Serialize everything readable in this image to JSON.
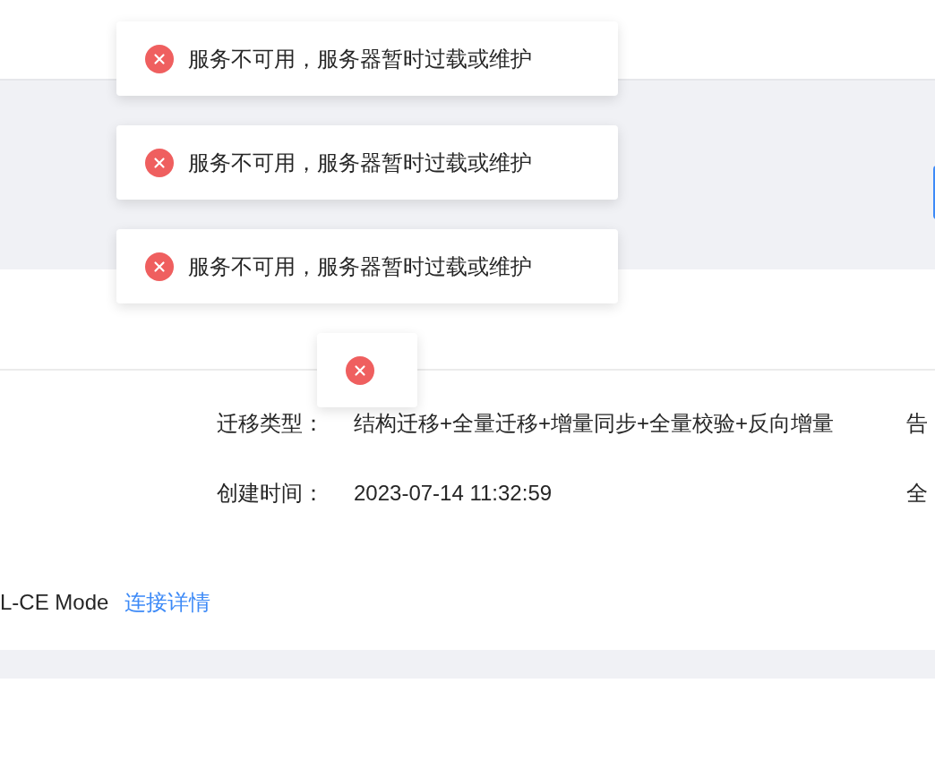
{
  "toasts": [
    {
      "kind": "error",
      "message": "服务不可用，服务器暂时过载或维护"
    },
    {
      "kind": "error",
      "message": "服务不可用，服务器暂时过载或维护"
    },
    {
      "kind": "error",
      "message": "服务不可用，服务器暂时过载或维护"
    },
    {
      "kind": "error"
    }
  ],
  "details": [
    {
      "label": "迁移类型：",
      "value": "结构迁移+全量迁移+增量同步+全量校验+反向增量",
      "column_3": "告"
    },
    {
      "label": "创建时间：",
      "value": "2023-07-14 11:32:59",
      "column_3": "全"
    }
  ],
  "connection": {
    "mode": "L-CE Mode",
    "link": "连接详情"
  }
}
